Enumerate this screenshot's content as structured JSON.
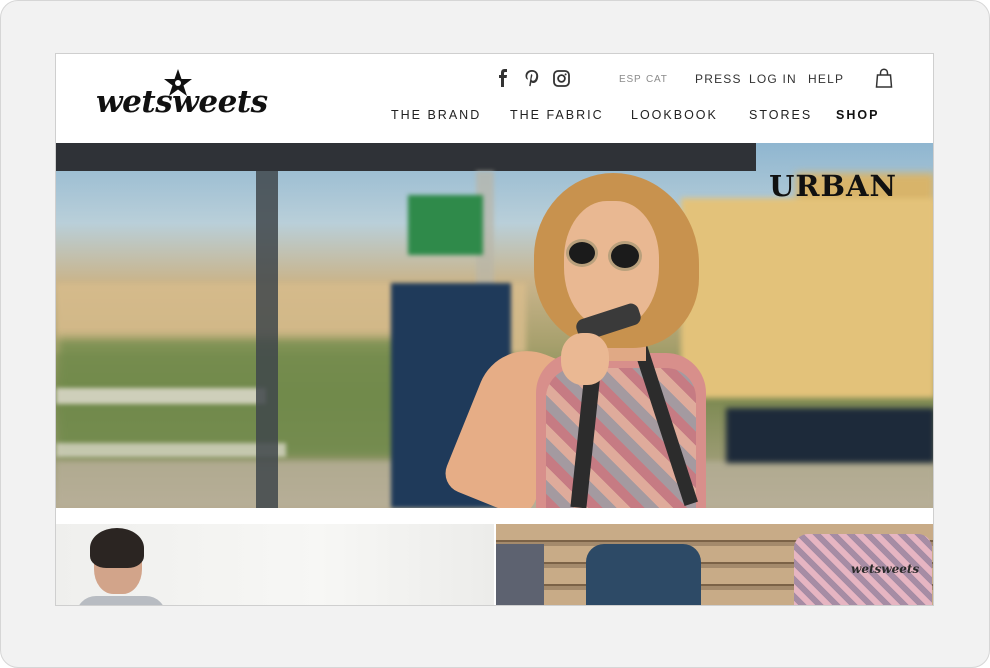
{
  "brand": {
    "name": "wetsweets",
    "thumb_name": "wetsweets"
  },
  "social": [
    {
      "name": "facebook-icon"
    },
    {
      "name": "pinterest-icon"
    },
    {
      "name": "instagram-icon"
    }
  ],
  "languages": [
    "ESP",
    "CAT"
  ],
  "utility_links": [
    "PRESS",
    "LOG IN",
    "HELP"
  ],
  "nav": [
    "THE BRAND",
    "THE FABRIC",
    "LOOKBOOK",
    "STORES",
    "SHOP"
  ],
  "hero": {
    "tag": "URBAN"
  },
  "colors": {
    "text": "#111111",
    "muted": "#8b8b8b",
    "frame": "#f2f2f2"
  }
}
